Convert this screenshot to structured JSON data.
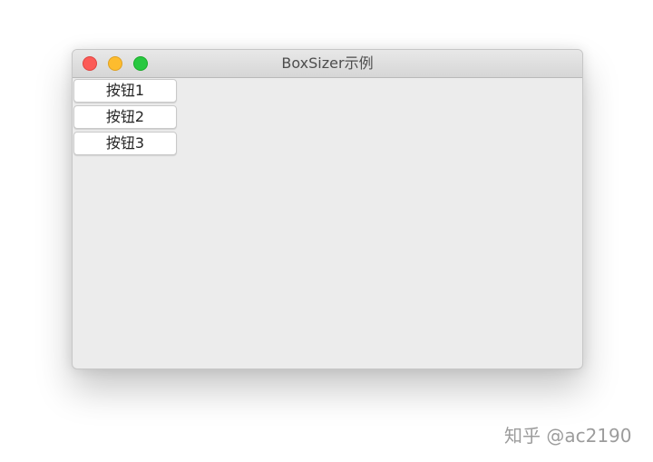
{
  "window": {
    "title": "BoxSizer示例",
    "controls": {
      "close": "close-icon",
      "minimize": "minimize-icon",
      "zoom": "zoom-icon"
    }
  },
  "buttons": [
    {
      "label": "按钮1"
    },
    {
      "label": "按钮2"
    },
    {
      "label": "按钮3"
    }
  ],
  "watermark": {
    "text": "知乎 @ac2190"
  },
  "colors": {
    "close": "#fc5b57",
    "minimize": "#fdbc2e",
    "zoom": "#28c840",
    "window_bg": "#ececec"
  }
}
